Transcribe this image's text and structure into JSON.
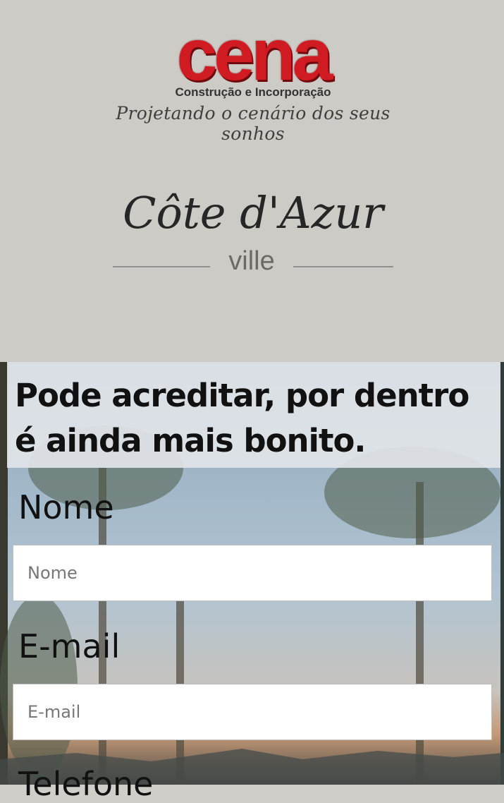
{
  "header": {
    "brand_logo": {
      "word": "cena",
      "subtitle": "Construção e Incorporação",
      "tagline": "Projetando o cenário dos seus sonhos"
    },
    "project_logo": {
      "title": "Côte d'Azur",
      "subtitle": "ville"
    }
  },
  "hero": {
    "headline": "Pode acreditar, por dentro é ainda mais bonito."
  },
  "form": {
    "name": {
      "label": "Nome",
      "placeholder": "Nome",
      "value": ""
    },
    "email": {
      "label": "E-mail",
      "placeholder": "E-mail",
      "value": ""
    },
    "phone": {
      "label": "Telefone"
    }
  },
  "colors": {
    "brand_red": "#d01b23",
    "header_bg": "#cccbc6",
    "headline_bg": "#e2e5e9"
  }
}
